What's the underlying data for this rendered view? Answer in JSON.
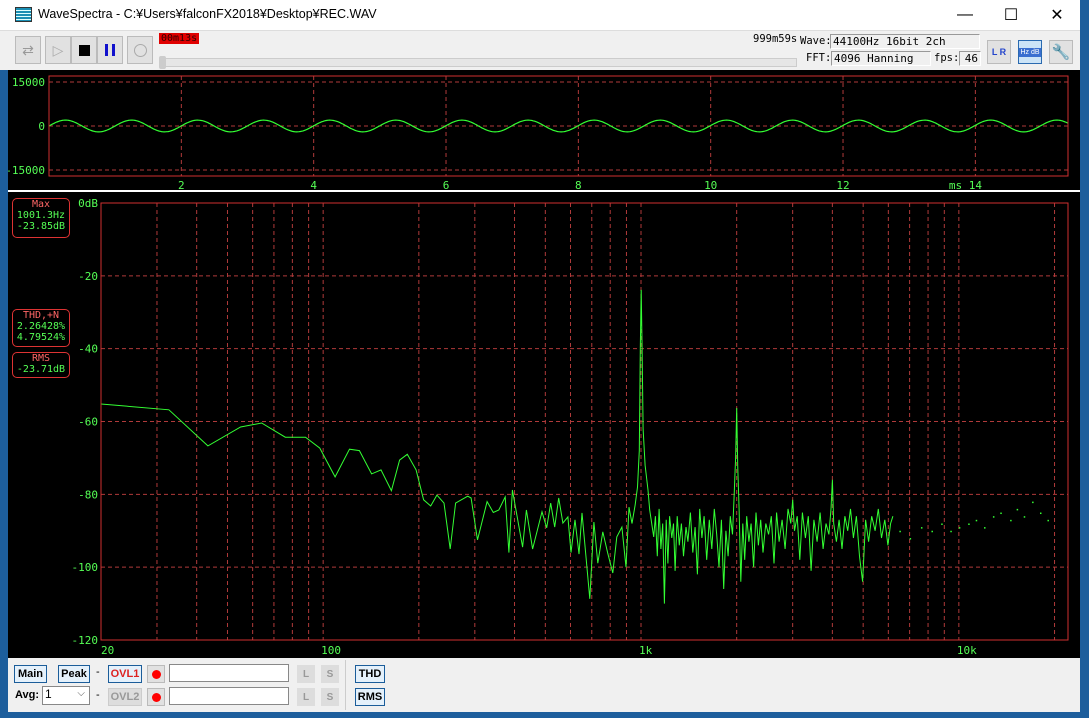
{
  "window": {
    "title": "WaveSpectra - C:¥Users¥falconFX2018¥Desktop¥REC.WAV",
    "minimize": "—",
    "maximize": "☐",
    "close": "✕"
  },
  "toolbar": {
    "elapsed": "00m13s",
    "total": "999m59s",
    "seek_position": 0.0,
    "wave_label": "Wave:",
    "wave_value": "44100Hz 16bit 2ch",
    "fft_label": "FFT:",
    "fft_value": "4096 Hanning",
    "fps_label": "fps:",
    "fps_value": "46",
    "lr_icon_text": "L R",
    "hzdb_icon_text": "Hz dB"
  },
  "readouts": {
    "max_title": "Max",
    "max_freq": "1001.3Hz",
    "max_level": "-23.85dB",
    "thd_title": "THD,+N",
    "thd": "2.26428%",
    "thdn": "4.79524%",
    "rms_title": "RMS",
    "rms_level": "-23.71dB"
  },
  "bottom": {
    "main": "Main",
    "peak": "Peak",
    "dash": "-",
    "ovl1": "OVL1",
    "ovl2": "OVL2",
    "avg_label": "Avg:",
    "avg_value": "1",
    "l": "L",
    "s": "S",
    "thd": "THD",
    "rms": "RMS"
  },
  "colors": {
    "trace": "#33ff33",
    "grid": "#b03a3a",
    "frame": "#d03030",
    "text": "#55ff55"
  },
  "chart_data": [
    {
      "type": "line",
      "title": "Waveform",
      "xlabel": "ms",
      "ylim": [
        -15000,
        15000
      ],
      "xlim": [
        0,
        15.4
      ],
      "yticks": [
        "15000",
        "0",
        "-15000"
      ],
      "yvals": [
        15000,
        0,
        -15000
      ],
      "xticks": [
        2,
        4,
        6,
        8,
        10,
        12,
        14
      ],
      "xtick_labels": [
        "2",
        "4",
        "6",
        "8",
        "10",
        "12",
        "14"
      ],
      "signal": {
        "frequency_hz": 1001.3,
        "amplitude": 2000
      }
    },
    {
      "type": "line",
      "title": "Spectrum",
      "xscale": "log",
      "xlim": [
        20,
        22050
      ],
      "ylim": [
        -120,
        0
      ],
      "yticks": [
        "0dB",
        "-20",
        "-40",
        "-60",
        "-80",
        "-100",
        "-120"
      ],
      "yvals": [
        0,
        -20,
        -40,
        -60,
        -80,
        -100,
        -120
      ],
      "xtick_labels": [
        "20",
        "100",
        "1k",
        "10k"
      ],
      "xtick_vals": [
        20,
        100,
        1000,
        10000
      ],
      "points": [
        [
          20,
          -55.2
        ],
        [
          32.7,
          -56.8
        ],
        [
          43.4,
          -66.7
        ],
        [
          55,
          -61.5
        ],
        [
          64,
          -60.4
        ],
        [
          76,
          -64.3
        ],
        [
          88,
          -64.3
        ],
        [
          97.6,
          -67.3
        ],
        [
          109,
          -75.2
        ],
        [
          121,
          -67.6
        ],
        [
          130,
          -68
        ],
        [
          142,
          -74.4
        ],
        [
          152,
          -73.3
        ],
        [
          164,
          -79
        ],
        [
          174,
          -70.6
        ],
        [
          184,
          -69
        ],
        [
          196,
          -73.3
        ],
        [
          207,
          -81.5
        ],
        [
          218,
          -83.2
        ],
        [
          228,
          -80.2
        ],
        [
          240,
          -82.4
        ],
        [
          251,
          -95
        ],
        [
          261,
          -82.4
        ],
        [
          285,
          -80.5
        ],
        [
          292,
          -81
        ],
        [
          306,
          -92.5
        ],
        [
          328,
          -82
        ],
        [
          343,
          -85
        ],
        [
          357,
          -84.3
        ],
        [
          374,
          -80.7
        ],
        [
          384,
          -96
        ],
        [
          394,
          -78.8
        ],
        [
          424,
          -94.5
        ],
        [
          436,
          -84.3
        ],
        [
          456,
          -95
        ],
        [
          488,
          -84.8
        ],
        [
          505,
          -89.2
        ],
        [
          520,
          -82.4
        ],
        [
          535,
          -89
        ],
        [
          551,
          -81
        ],
        [
          568,
          -87.9
        ],
        [
          589,
          -86.2
        ],
        [
          602,
          -96
        ],
        [
          620,
          -87
        ],
        [
          638,
          -96.4
        ],
        [
          652,
          -85.1
        ],
        [
          690,
          -108.7
        ],
        [
          711,
          -87.6
        ],
        [
          731,
          -98.9
        ],
        [
          758,
          -90.3
        ],
        [
          785,
          -96
        ],
        [
          815,
          -101.6
        ],
        [
          839,
          -91.7
        ],
        [
          871,
          -89
        ],
        [
          897,
          -100
        ],
        [
          917,
          -83.5
        ],
        [
          937,
          -88
        ],
        [
          958,
          -83
        ],
        [
          975,
          -78
        ],
        [
          988,
          -68
        ],
        [
          995,
          -40
        ],
        [
          1001.3,
          -23.85
        ],
        [
          1008,
          -40
        ],
        [
          1015,
          -62
        ],
        [
          1030,
          -72
        ],
        [
          1052,
          -78.8
        ],
        [
          1065,
          -84.3
        ],
        [
          1096,
          -91.7
        ],
        [
          1110,
          -86
        ],
        [
          1125,
          -97
        ],
        [
          1140,
          -84
        ],
        [
          1155,
          -95
        ],
        [
          1170,
          -88
        ],
        [
          1185,
          -110
        ],
        [
          1200,
          -87
        ],
        [
          1215,
          -99
        ],
        [
          1230,
          -86
        ],
        [
          1250,
          -92
        ],
        [
          1265,
          -88
        ],
        [
          1280,
          -101
        ],
        [
          1300,
          -86
        ],
        [
          1320,
          -94
        ],
        [
          1340,
          -88
        ],
        [
          1360,
          -97
        ],
        [
          1385,
          -89
        ],
        [
          1405,
          -93
        ],
        [
          1430,
          -85
        ],
        [
          1455,
          -96
        ],
        [
          1480,
          -89
        ],
        [
          1505,
          -102
        ],
        [
          1530,
          -84
        ],
        [
          1555,
          -92
        ],
        [
          1580,
          -86
        ],
        [
          1610,
          -98
        ],
        [
          1640,
          -87
        ],
        [
          1670,
          -95
        ],
        [
          1700,
          -84
        ],
        [
          1730,
          -91
        ],
        [
          1760,
          -100
        ],
        [
          1790,
          -87
        ],
        [
          1820,
          -106
        ],
        [
          1850,
          -90
        ],
        [
          1880,
          -97
        ],
        [
          1910,
          -86
        ],
        [
          1940,
          -91
        ],
        [
          1965,
          -80
        ],
        [
          1985,
          -70
        ],
        [
          2000,
          -56.3
        ],
        [
          2015,
          -72
        ],
        [
          2035,
          -84
        ],
        [
          2060,
          -104
        ],
        [
          2090,
          -88
        ],
        [
          2120,
          -98
        ],
        [
          2150,
          -86
        ],
        [
          2185,
          -93
        ],
        [
          2220,
          -88
        ],
        [
          2260,
          -100
        ],
        [
          2300,
          -85
        ],
        [
          2340,
          -94
        ],
        [
          2380,
          -87
        ],
        [
          2420,
          -96
        ],
        [
          2470,
          -88
        ],
        [
          2520,
          -91
        ],
        [
          2570,
          -86
        ],
        [
          2620,
          -99
        ],
        [
          2670,
          -85
        ],
        [
          2720,
          -93
        ],
        [
          2780,
          -87
        ],
        [
          2840,
          -95
        ],
        [
          2900,
          -84
        ],
        [
          2960,
          -88
        ],
        [
          3000,
          -81.5
        ],
        [
          3040,
          -90
        ],
        [
          3100,
          -86
        ],
        [
          3160,
          -98
        ],
        [
          3220,
          -85
        ],
        [
          3290,
          -92
        ],
        [
          3360,
          -86
        ],
        [
          3430,
          -101
        ],
        [
          3500,
          -87
        ],
        [
          3580,
          -93
        ],
        [
          3660,
          -85
        ],
        [
          3740,
          -95
        ],
        [
          3820,
          -88
        ],
        [
          3900,
          -91
        ],
        [
          3960,
          -84
        ],
        [
          4000,
          -76
        ],
        [
          4040,
          -88
        ],
        [
          4120,
          -93
        ],
        [
          4200,
          -87
        ],
        [
          4290,
          -95
        ],
        [
          4380,
          -86
        ],
        [
          4470,
          -90
        ],
        [
          4560,
          -84
        ],
        [
          4660,
          -92
        ],
        [
          4760,
          -86
        ],
        [
          4870,
          -97
        ],
        [
          4980,
          -104
        ],
        [
          5090,
          -87
        ],
        [
          5200,
          -93
        ],
        [
          5320,
          -86
        ],
        [
          5450,
          -90
        ],
        [
          5580,
          -84
        ],
        [
          5710,
          -92
        ],
        [
          5850,
          -87
        ],
        [
          5980,
          -94
        ],
        [
          6100,
          -88
        ],
        [
          6200,
          -86
        ]
      ],
      "dots": [
        [
          6500,
          -90
        ],
        [
          7000,
          -92
        ],
        [
          7600,
          -89
        ],
        [
          8200,
          -90
        ],
        [
          8800,
          -88
        ],
        [
          9400,
          -90
        ],
        [
          10000,
          -89
        ],
        [
          10700,
          -88
        ],
        [
          11300,
          -87
        ],
        [
          12000,
          -89
        ],
        [
          12800,
          -86
        ],
        [
          13500,
          -85
        ],
        [
          14500,
          -87
        ],
        [
          15200,
          -84
        ],
        [
          16000,
          -86
        ],
        [
          17000,
          -82
        ],
        [
          18000,
          -85
        ],
        [
          19000,
          -87
        ]
      ]
    }
  ]
}
